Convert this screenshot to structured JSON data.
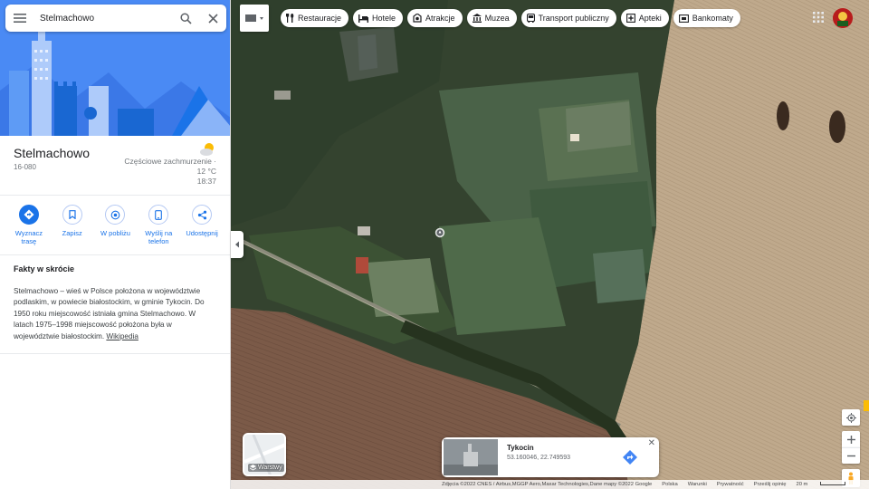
{
  "search": {
    "value": "Stelmachowo"
  },
  "place": {
    "title": "Stelmachowo",
    "postal": "16-080",
    "weather_desc": "Częściowe zachmurzenie ·",
    "weather_temp": "12 °C",
    "weather_time": "18:37",
    "weather_icon": "partly-cloudy-icon"
  },
  "actions": [
    {
      "label": "Wyznacz trasę",
      "icon": "directions-icon"
    },
    {
      "label": "Zapisz",
      "icon": "bookmark-icon"
    },
    {
      "label": "W pobliżu",
      "icon": "nearby-icon"
    },
    {
      "label": "Wyślij na telefon",
      "icon": "phone-icon"
    },
    {
      "label": "Udostępnij",
      "icon": "share-icon"
    }
  ],
  "facts": {
    "heading": "Fakty w skrócie",
    "text": "Stelmachowo – wieś w Polsce położona w województwie podlaskim, w powiecie białostockim, w gminie Tykocin. Do 1950 roku miejscowość istniała gmina Stelmachowo. W latach 1975–1998 miejscowość położona była w województwie białostockim.",
    "link": "Wikipedia"
  },
  "chips": [
    {
      "label": "Restauracje",
      "icon": "fork-knife-icon"
    },
    {
      "label": "Hotele",
      "icon": "bed-icon"
    },
    {
      "label": "Atrakcje",
      "icon": "camera-icon"
    },
    {
      "label": "Muzea",
      "icon": "museum-icon"
    },
    {
      "label": "Transport publiczny",
      "icon": "bus-icon"
    },
    {
      "label": "Apteki",
      "icon": "pharmacy-icon"
    },
    {
      "label": "Bankomaty",
      "icon": "atm-icon"
    }
  ],
  "layers": {
    "label": "Warstwy"
  },
  "infocard": {
    "name": "Tykocin",
    "coords": "53.160046, 22.749593"
  },
  "attribution": {
    "imagery": "Zdjęcia ©2022 CNES / Airbus,MGGP Aero,Maxar Technologies,Dane mapy ©2022 Google",
    "country": "Polska",
    "terms": "Warunki",
    "privacy": "Prywatność",
    "feedback": "Prześlij opinię",
    "scale": "20 m"
  },
  "colors": {
    "accent": "#1a73e8",
    "hero_bg": "#4285f4",
    "field": "#b8a58a",
    "plowed": "#7a5b4a"
  }
}
